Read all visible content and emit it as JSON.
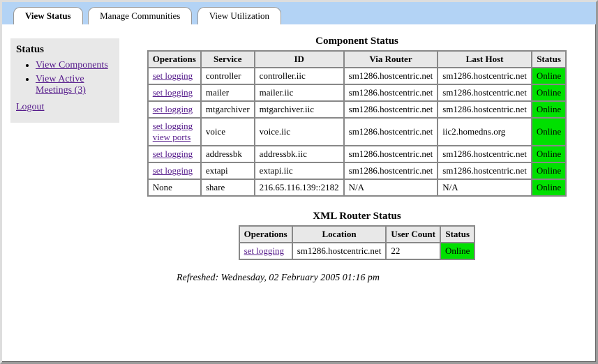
{
  "tabs": {
    "view_status": "View Status",
    "manage_communities": "Manage Communities",
    "view_utilization": "View Utilization"
  },
  "sidebar": {
    "heading": "Status",
    "view_components": "View Components",
    "view_active_meetings": "View Active Meetings (3)",
    "logout": "Logout"
  },
  "component_status": {
    "title": "Component Status",
    "headers": {
      "operations": "Operations",
      "service": "Service",
      "id": "ID",
      "via_router": "Via Router",
      "last_host": "Last Host",
      "status": "Status"
    },
    "rows": [
      {
        "ops": [
          "set logging"
        ],
        "service": "controller",
        "id": "controller.iic",
        "via_router": "sm1286.hostcentric.net",
        "last_host": "sm1286.hostcentric.net",
        "status": "Online"
      },
      {
        "ops": [
          "set logging"
        ],
        "service": "mailer",
        "id": "mailer.iic",
        "via_router": "sm1286.hostcentric.net",
        "last_host": "sm1286.hostcentric.net",
        "status": "Online"
      },
      {
        "ops": [
          "set logging"
        ],
        "service": "mtgarchiver",
        "id": "mtgarchiver.iic",
        "via_router": "sm1286.hostcentric.net",
        "last_host": "sm1286.hostcentric.net",
        "status": "Online"
      },
      {
        "ops": [
          "set logging",
          "view ports"
        ],
        "service": "voice",
        "id": "voice.iic",
        "via_router": "sm1286.hostcentric.net",
        "last_host": "iic2.homedns.org",
        "status": "Online"
      },
      {
        "ops": [
          "set logging"
        ],
        "service": "addressbk",
        "id": "addressbk.iic",
        "via_router": "sm1286.hostcentric.net",
        "last_host": "sm1286.hostcentric.net",
        "status": "Online"
      },
      {
        "ops": [
          "set logging"
        ],
        "service": "extapi",
        "id": "extapi.iic",
        "via_router": "sm1286.hostcentric.net",
        "last_host": "sm1286.hostcentric.net",
        "status": "Online"
      },
      {
        "ops_text": "None",
        "service": "share",
        "id": "216.65.116.139::2182",
        "via_router": "N/A",
        "last_host": "N/A",
        "status": "Online"
      }
    ]
  },
  "router_status": {
    "title": "XML Router Status",
    "headers": {
      "operations": "Operations",
      "location": "Location",
      "user_count": "User Count",
      "status": "Status"
    },
    "rows": [
      {
        "op": "set logging",
        "location": "sm1286.hostcentric.net",
        "user_count": "22",
        "status": "Online"
      }
    ]
  },
  "refreshed": "Refreshed: Wednesday, 02 February 2005 01:16 pm"
}
